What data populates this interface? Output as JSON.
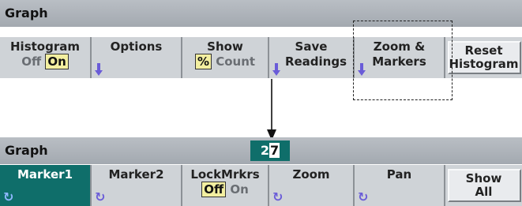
{
  "top": {
    "title": "Graph",
    "keys": [
      {
        "l1": "Histogram",
        "off": "Off",
        "on": "On"
      },
      {
        "l1": "Options"
      },
      {
        "l1": "Show",
        "pct": "%",
        "count": "Count"
      },
      {
        "l1": "Save",
        "l2": "Readings"
      },
      {
        "l1": "Zoom &",
        "l2": "Markers"
      },
      {
        "l1": "Reset",
        "l2": "Histogram"
      }
    ]
  },
  "bottom": {
    "title": "Graph",
    "display": {
      "digit1": "2",
      "digit2": "7"
    },
    "keys": [
      {
        "l1": "Marker1"
      },
      {
        "l1": "Marker2"
      },
      {
        "l1": "LockMrkrs",
        "off": "Off",
        "on": "On"
      },
      {
        "l1": "Zoom"
      },
      {
        "l1": "Pan"
      },
      {
        "l1": "Show",
        "l2": "All"
      }
    ]
  },
  "colors": {
    "accent": "#0f6e6a",
    "blue_arrow": "#6a5cd8"
  }
}
